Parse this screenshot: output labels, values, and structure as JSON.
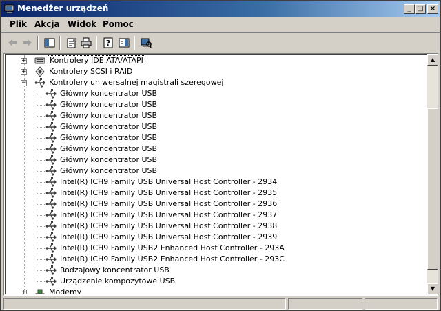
{
  "window": {
    "title": "Menedżer urządzeń",
    "controls": {
      "minimize": "_",
      "maximize": "□",
      "close": "×"
    }
  },
  "menu": [
    {
      "label": "Plik"
    },
    {
      "label": "Akcja"
    },
    {
      "label": "Widok"
    },
    {
      "label": "Pomoc"
    }
  ],
  "toolbar": {
    "buttons": [
      {
        "icon": "back-arrow-icon"
      },
      {
        "icon": "forward-arrow-icon"
      },
      {
        "icon": "show-hide-console-tree-icon"
      },
      {
        "icon": "properties-icon"
      },
      {
        "icon": "print-icon"
      },
      {
        "icon": "help-icon"
      },
      {
        "icon": "show-hide-action-pane-icon"
      },
      {
        "icon": "scan-hardware-icon"
      }
    ]
  },
  "tree": {
    "categories": [
      {
        "label": "Kontrolery IDE ATA/ATAPI",
        "expanded": false,
        "selected": true,
        "icon": "ide-controller-icon"
      },
      {
        "label": "Kontrolery SCSI i RAID",
        "expanded": false,
        "selected": false,
        "icon": "scsi-controller-icon"
      },
      {
        "label": "Kontrolery uniwersalnej magistrali szeregowej",
        "expanded": true,
        "selected": false,
        "icon": "usb-icon"
      }
    ],
    "usb_children": [
      "Główny koncentrator USB",
      "Główny koncentrator USB",
      "Główny koncentrator USB",
      "Główny koncentrator USB",
      "Główny koncentrator USB",
      "Główny koncentrator USB",
      "Główny koncentrator USB",
      "Główny koncentrator USB",
      "Intel(R) ICH9 Family USB Universal Host Controller - 2934",
      "Intel(R) ICH9 Family USB Universal Host Controller - 2935",
      "Intel(R) ICH9 Family USB Universal Host Controller - 2936",
      "Intel(R) ICH9 Family USB Universal Host Controller - 2937",
      "Intel(R) ICH9 Family USB Universal Host Controller - 2938",
      "Intel(R) ICH9 Family USB Universal Host Controller - 2939",
      "Intel(R) ICH9 Family USB2 Enhanced Host Controller - 293A",
      "Intel(R) ICH9 Family USB2 Enhanced Host Controller - 293C",
      "Rodzajowy koncentrator USB",
      "Urządzenie kompozytowe USB"
    ],
    "after": [
      {
        "label": "Modemy",
        "expanded": false,
        "icon": "modem-icon"
      }
    ]
  },
  "colors": {
    "title_start": "#0a246a",
    "title_end": "#a6caf0",
    "face": "#d4d0c8"
  }
}
